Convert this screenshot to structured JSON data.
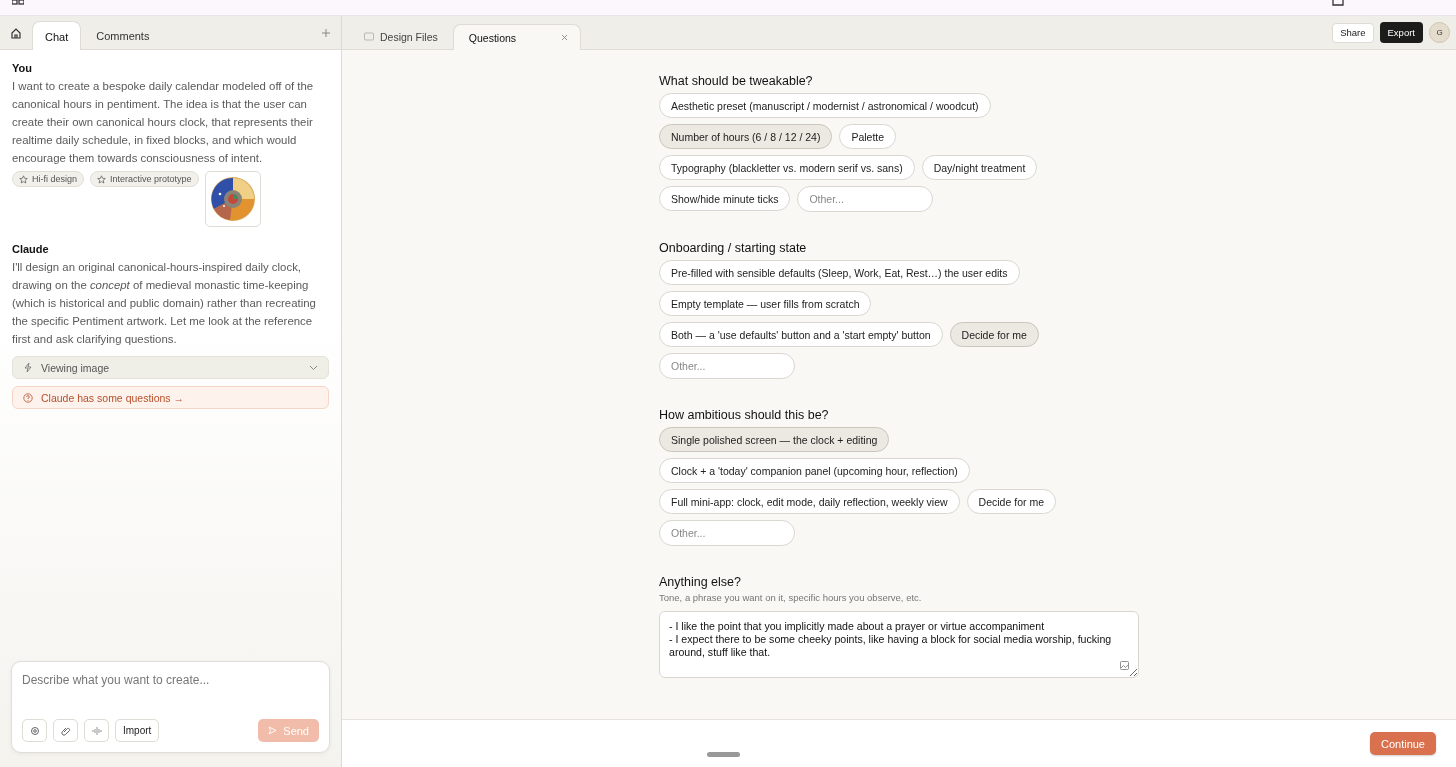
{
  "chat_tabs": [
    {
      "label": "Chat",
      "selected": true
    },
    {
      "label": "Comments",
      "selected": false
    }
  ],
  "messages": [
    {
      "author": "You",
      "text": "I want to create a bespoke daily calendar modeled off of the canonical hours in pentiment. The idea is that the user can create their own canonical hours clock, that represents their realtime daily schedule, in fixed blocks, and which would encourage them towards consciousness of intent.",
      "chips": [
        "Hi-fi design",
        "Interactive prototype"
      ],
      "attachment": {
        "kind": "picture"
      }
    },
    {
      "author": "Claude",
      "text": "I'll design an original canonical-hours-inspired daily clock, drawing on the *concept* of medieval monastic time-keeping (which is historical and public domain) rather than recreating the specific Pentiment artwork. Let me look at the reference first and ask clarifying questions."
    }
  ],
  "activity": {
    "label": "Viewing image",
    "expanded": false
  },
  "notice": "Claude has some questions →",
  "composer": {
    "placeholder": "Describe what you want to create...",
    "import": "Import",
    "send": {
      "label": "Send",
      "disabled": true
    }
  },
  "doc_tabs": [
    {
      "label": "Design Files",
      "selected": false,
      "closable": false
    },
    {
      "label": "Questions",
      "selected": true,
      "closable": true
    }
  ],
  "header": {
    "share": "Share",
    "export": "Export",
    "avatar": "G"
  },
  "questions": [
    {
      "title": "What should be tweakable?",
      "options": [
        {
          "label": "Aesthetic preset (manuscript / modernist / astronomical / woodcut)",
          "selected": false
        },
        {
          "label": "Number of hours (6 / 8 / 12 / 24)",
          "selected": true
        },
        {
          "label": "Palette",
          "selected": false
        },
        {
          "label": "Typography (blackletter vs. modern serif vs. sans)",
          "selected": false
        },
        {
          "label": "Day/night treatment",
          "selected": false
        },
        {
          "label": "Show/hide minute ticks",
          "selected": false
        }
      ],
      "placeholder": "Other..."
    },
    {
      "title": "Onboarding / starting state",
      "options": [
        {
          "label": "Pre-filled with sensible defaults (Sleep, Work, Eat, Rest…) the user edits",
          "selected": false
        },
        {
          "label": "Empty template — user fills from scratch",
          "selected": false
        },
        {
          "label": "Both — a 'use defaults' button and a 'start empty' button",
          "selected": false
        },
        {
          "label": "Decide for me",
          "selected": true
        }
      ],
      "placeholder": "Other..."
    },
    {
      "title": "How ambitious should this be?",
      "options": [
        {
          "label": "Single polished screen — the clock + editing",
          "selected": true
        },
        {
          "label": "Clock + a 'today' companion panel (upcoming hour, reflection)",
          "selected": false
        },
        {
          "label": "Full mini-app: clock, edit mode, daily reflection, weekly view",
          "selected": false
        },
        {
          "label": "Decide for me",
          "selected": false
        }
      ],
      "placeholder": "Other..."
    }
  ],
  "free_text": {
    "title": "Anything else?",
    "hint": "Tone, a phrase you want on it, specific hours you observe, etc.",
    "value": "- I like the point that you implicitly made about a prayer or virtue accompaniment\n- I expect there to be some cheeky points, like having a block for social media worship, fucking around, stuff like that."
  },
  "continue": "Continue"
}
